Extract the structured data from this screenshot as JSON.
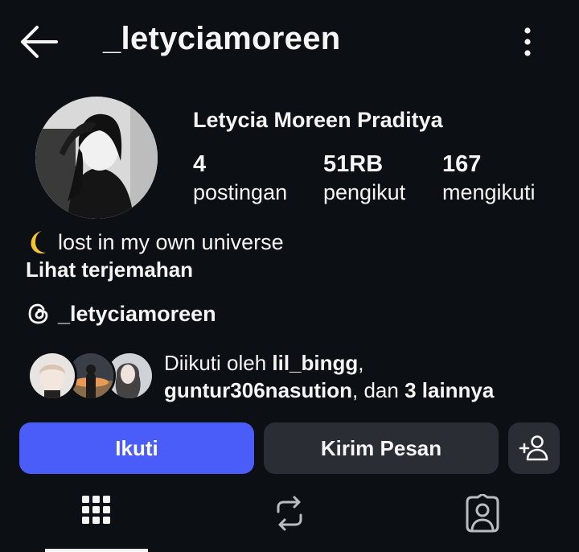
{
  "header": {
    "username": "_letyciamoreen",
    "back_icon": "arrow-left-icon",
    "more_icon": "more-vertical-icon"
  },
  "profile": {
    "full_name": "Letycia Moreen Praditya",
    "stats": {
      "posts": {
        "value": "4",
        "label": "postingan"
      },
      "followers": {
        "value": "51RB",
        "label": "pengikut"
      },
      "following": {
        "value": "167",
        "label": "mengikuti"
      }
    },
    "bio": "lost in my own universe",
    "bio_emoji": "crescent-moon-icon",
    "see_translation": "Lihat terjemahan",
    "threads_handle": "_letyciamoreen"
  },
  "followed_by": {
    "prefix": "Diikuti oleh ",
    "user1": "lil_bingg",
    "sep1": ",",
    "user2": "guntur306nasution",
    "sep2": ", dan ",
    "others": "3 lainnya"
  },
  "actions": {
    "follow": "Ikuti",
    "message": "Kirim Pesan",
    "suggest_icon": "add-person-icon"
  },
  "tabs": {
    "active": "grid",
    "items": [
      "grid-icon",
      "repost-icon",
      "tagged-icon"
    ]
  },
  "colors": {
    "background": "#0c0f14",
    "follow_button": "#4a5df9",
    "secondary_button": "#2a2d33",
    "text": "#f5f5f5"
  }
}
